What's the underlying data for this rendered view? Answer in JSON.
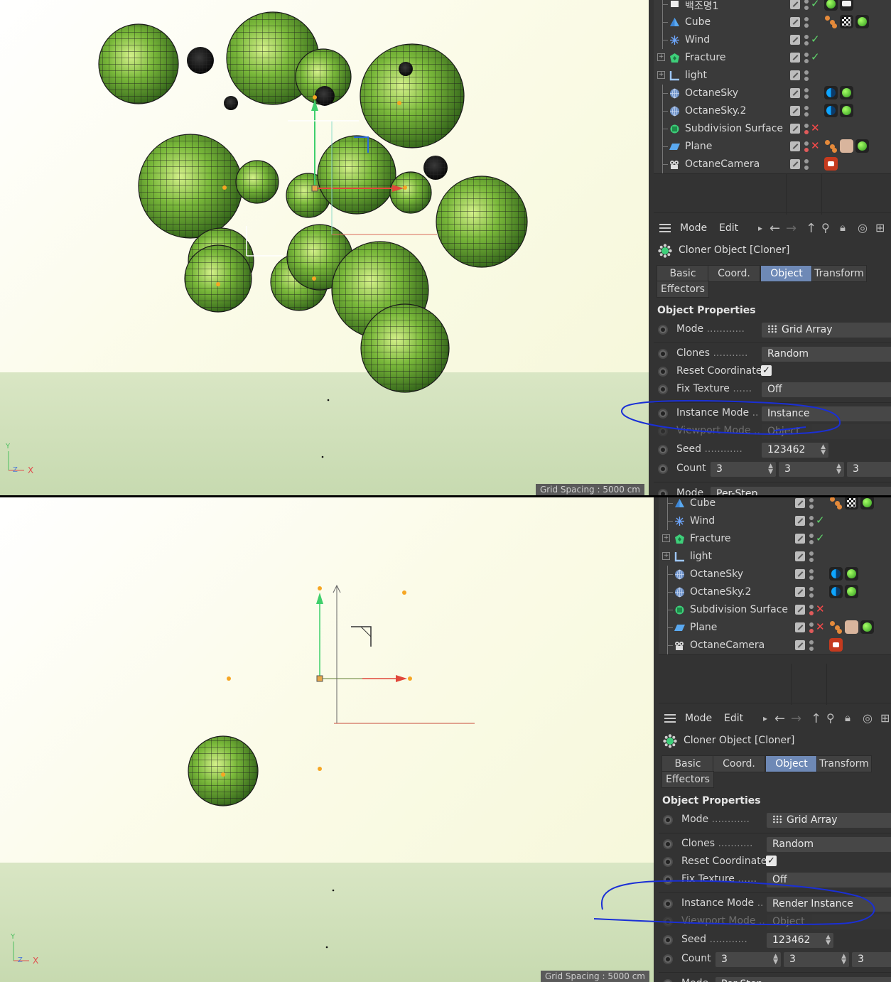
{
  "viewport": {
    "grid_spacing": "Grid Spacing : 5000 cm",
    "axis_y": "Y",
    "axis_z": "Z",
    "axis_x": "X"
  },
  "objects": [
    {
      "name": "백조명1",
      "icon": "light-icon",
      "status": "ok",
      "tags": [
        "green-material",
        "white-tag"
      ]
    },
    {
      "name": "Cube",
      "icon": "cube-icon",
      "status": "none",
      "tags": [
        "cluster",
        "checker-material",
        "green-material"
      ]
    },
    {
      "name": "Wind",
      "icon": "wind-icon",
      "status": "ok",
      "tags": []
    },
    {
      "name": "Fracture",
      "icon": "fracture-icon",
      "status": "ok",
      "tags": []
    },
    {
      "name": "light",
      "icon": "null-icon",
      "status": "none",
      "tags": []
    },
    {
      "name": "OctaneSky",
      "icon": "sky-icon",
      "status": "none",
      "tags": [
        "blue-tag",
        "green-material"
      ]
    },
    {
      "name": "OctaneSky.2",
      "icon": "sky-icon",
      "status": "none",
      "tags": [
        "blue-tag",
        "green-material"
      ]
    },
    {
      "name": "Subdivision Surface",
      "icon": "subdivision-icon",
      "status": "bad",
      "tags": []
    },
    {
      "name": "Plane",
      "icon": "plane-icon",
      "status": "bad",
      "tags": [
        "cluster",
        "face-material",
        "green-material"
      ]
    },
    {
      "name": "OctaneCamera",
      "icon": "camera-icon",
      "status": "none",
      "tags": [
        "camera-tag"
      ]
    }
  ],
  "attributes": {
    "menu": {
      "mode": "Mode",
      "edit": "Edit"
    },
    "object_title": "Cloner Object [Cloner]",
    "tabs": [
      "Basic",
      "Coord.",
      "Object",
      "Transform",
      "Effectors"
    ],
    "active_tab": "Object",
    "section": "Object Properties",
    "labels": {
      "mode": "Mode",
      "clones": "Clones",
      "reset_coordinates": "Reset Coordinates",
      "fix_texture": "Fix Texture",
      "instance_mode": "Instance Mode",
      "viewport_mode": "Viewport Mode",
      "seed": "Seed",
      "count": "Count",
      "mode2": "Mode"
    },
    "values": {
      "mode": "Grid Array",
      "clones": "Random",
      "fix_texture": "Off",
      "viewport_mode": "Object",
      "seed": "123462",
      "count": [
        "3",
        "3",
        "3"
      ],
      "mode2": "Per-Step"
    }
  },
  "top": {
    "instance_mode": "Instance"
  },
  "bottom": {
    "instance_mode": "Render Instance"
  },
  "colors": {
    "panel_bg": "#333333",
    "active_tab": "#6e89b6",
    "annotation": "#1a2fd6",
    "sphere_green": "#6fb52a"
  }
}
